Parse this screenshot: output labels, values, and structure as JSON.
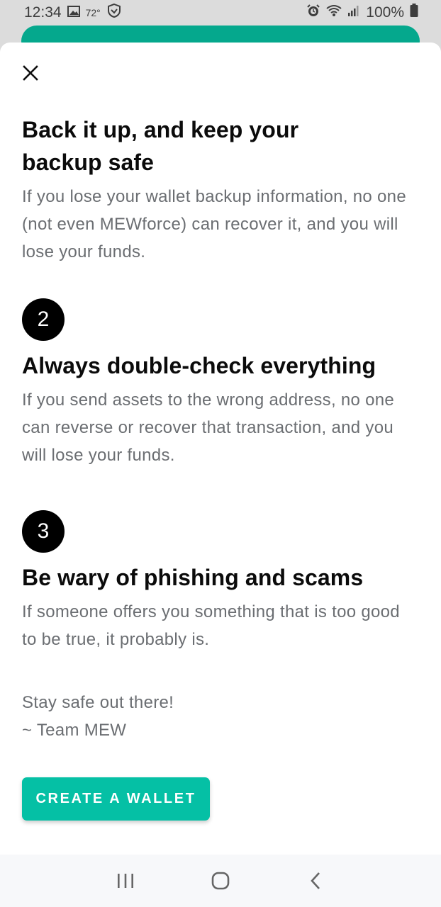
{
  "status_bar": {
    "time": "12:34",
    "temperature": "72°",
    "battery": "100%",
    "icons": [
      "image-icon",
      "shield-icon",
      "alarm-icon",
      "wifi-icon",
      "signal-icon",
      "battery-icon"
    ]
  },
  "sheet": {
    "close_icon": "close-icon",
    "sections": [
      {
        "title": "Back it up, and keep your backup safe",
        "body": "If you lose your wallet backup information, no one (not even MEWforce) can recover it, and you will lose your funds."
      },
      {
        "number": "2",
        "title": "Always double-check everything",
        "body": "If you send assets to the wrong address, no one can reverse or recover that transaction, and you will lose your funds."
      },
      {
        "number": "3",
        "title": "Be wary of phishing and scams",
        "body": "If someone offers you something that is too good to be true, it probably is."
      }
    ],
    "signoff_line1": "Stay safe out there!",
    "signoff_line2": "~ Team MEW",
    "cta_label": "CREATE A WALLET"
  },
  "colors": {
    "accent": "#05c0a5",
    "header_teal": "#05a88d",
    "text_primary": "#0b0b0b",
    "text_secondary": "#6b6e72"
  },
  "nav_bar": {
    "icons": [
      "recent-apps-icon",
      "home-icon",
      "back-icon"
    ]
  }
}
